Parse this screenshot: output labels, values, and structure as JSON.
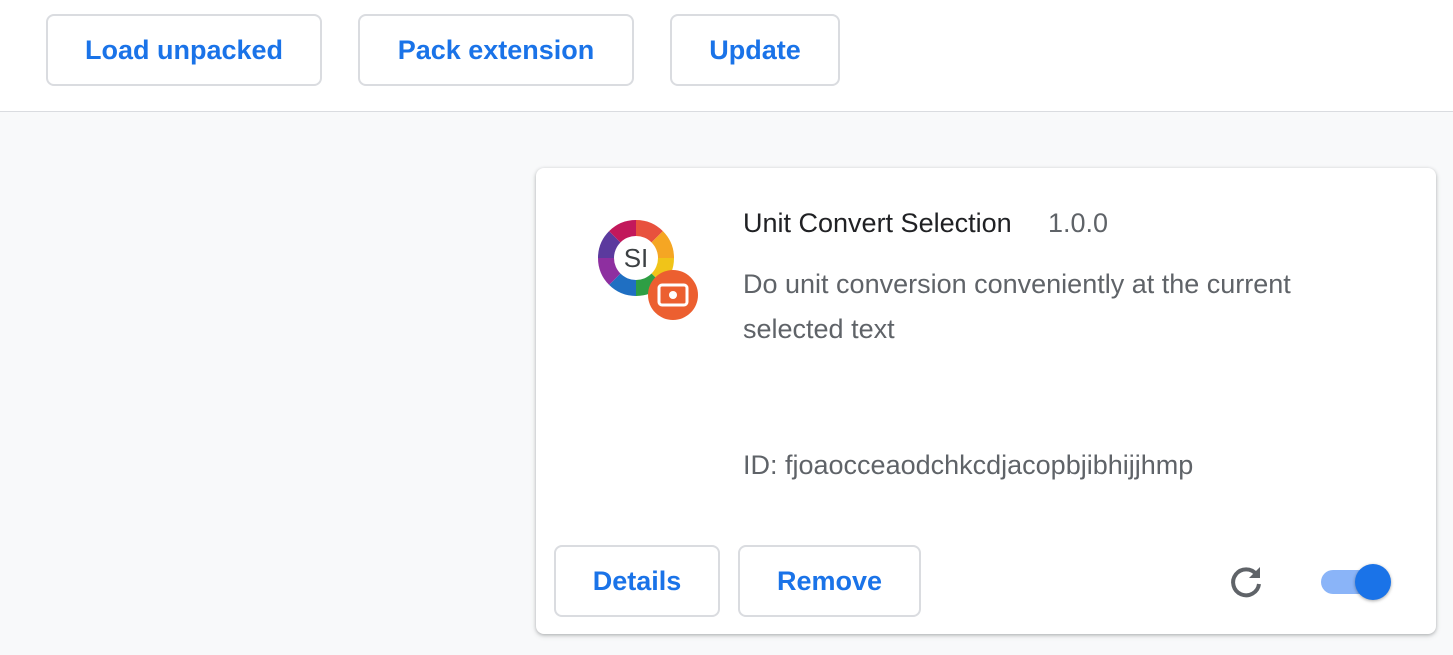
{
  "toolbar": {
    "load_unpacked_label": "Load unpacked",
    "pack_extension_label": "Pack extension",
    "update_label": "Update"
  },
  "extension": {
    "name": "Unit Convert Selection",
    "version": "1.0.0",
    "description": "Do unit conversion conveniently at the current selected text",
    "id_text": "ID: fjoaocceaodchkcdjacopbjibhijjhmp",
    "icon_label": "SI",
    "icon_name": "si-units-wheel-icon",
    "badge_icon_name": "unpacked-extension-badge-icon",
    "details_label": "Details",
    "remove_label": "Remove",
    "reload_icon_name": "reload-icon",
    "enabled": true
  },
  "colors": {
    "accent": "#1a73e8",
    "toggle_track": "#8ab4f8",
    "badge": "#ec5f30",
    "background": "#f8f9fa"
  }
}
